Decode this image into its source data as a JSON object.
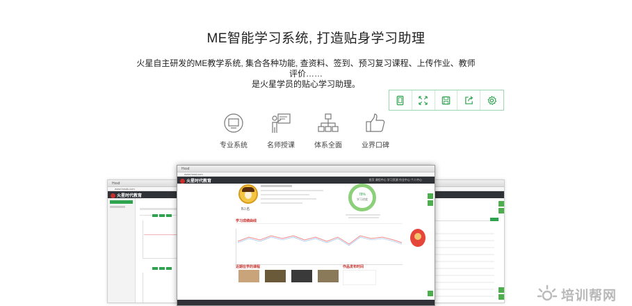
{
  "hero": {
    "title": "ME智能学习系统, 打造贴身学习助理",
    "desc_line1": "火星自主研发的ME教学系统, 集合各种功能, 查资料、签到、预习复习课程、上传作业、教师",
    "desc_line2": "评价……",
    "desc_line3": "是火星学员的贴心学习助理。"
  },
  "toolbar": {
    "items": [
      {
        "icon": "tablet-icon"
      },
      {
        "icon": "fullscreen-icon"
      },
      {
        "icon": "save-icon"
      },
      {
        "icon": "share-icon"
      },
      {
        "icon": "settings-icon"
      }
    ]
  },
  "features": [
    {
      "label": "专业系统",
      "icon": "monitor-icon"
    },
    {
      "label": "名师授课",
      "icon": "teacher-icon"
    },
    {
      "label": "体系全面",
      "icon": "hierarchy-icon"
    },
    {
      "label": "业界口碑",
      "icon": "thumbs-up-icon"
    }
  ],
  "screens": {
    "logo": "火星时代教育",
    "main_tab": "Hxsd",
    "main_url": "www.hxsd.com",
    "left_tab": "Hxsd",
    "left_url": "www.hxsds.com",
    "avatar_name": "BJ.名",
    "progress_label": "学习进度",
    "progress_value": "78%",
    "chart_title": "学习成绩曲线",
    "courses_title": "近期在学的课程",
    "notices_title": "作品发布时间",
    "nav_items": "首页  课程中心  学习资源  作业中心  个人中心"
  },
  "watermark": {
    "text": "培训帮网"
  },
  "colors": {
    "accent": "#2fa44f",
    "toolbar_border": "#9cd8ae",
    "dark_bar": "#2f3237"
  }
}
